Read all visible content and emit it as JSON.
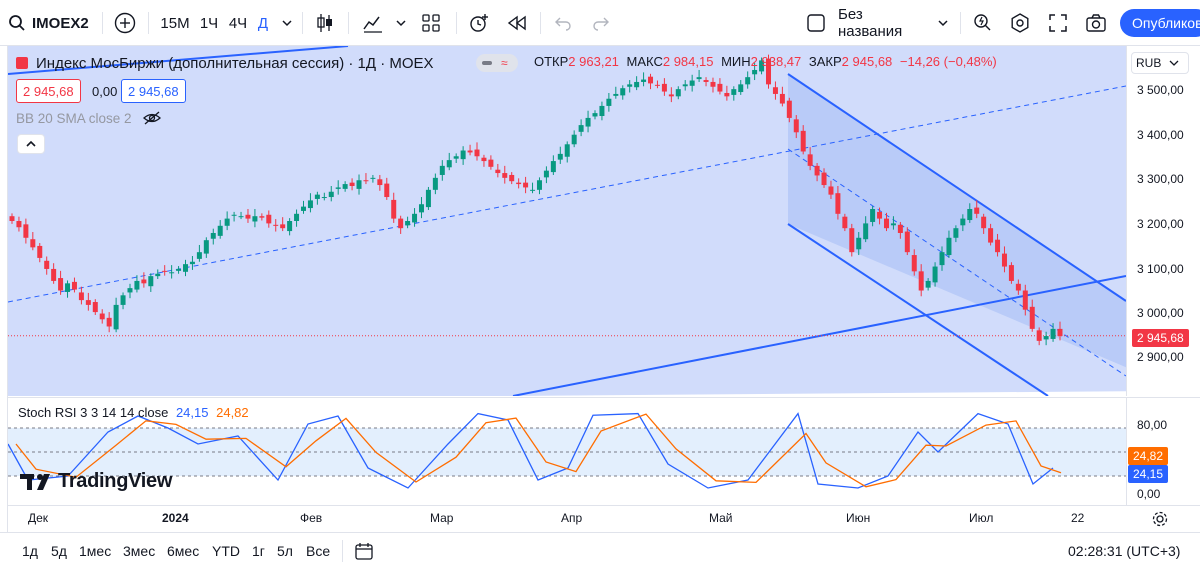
{
  "toolbar": {
    "symbol": "IMOEX2",
    "add_label": "+",
    "intervals": [
      "15М",
      "1Ч",
      "4Ч",
      "Д"
    ],
    "active_interval": "Д",
    "layout_name": "Без названия",
    "publish_label": "Опубликов"
  },
  "legend": {
    "title": "Индекс МосБиржи (дополнительная сессия) · 1Д · MOEX",
    "open_label": "ОТКР",
    "open": "2 963,21",
    "high_label": "МАКС",
    "high": "2 984,15",
    "low_label": "МИН",
    "low": "2 938,47",
    "close_label": "ЗАКР",
    "close": "2 945,68",
    "change": "−14,26 (−0,48%)",
    "bid": "2 945,68",
    "spread": "0,00",
    "ask": "2 945,68",
    "bb_label": "BB 20 SMA close 2",
    "collapse_icon": "^"
  },
  "price_scale": {
    "currency": "RUB",
    "ticks": [
      "3 500,00",
      "3 400,00",
      "3 300,00",
      "3 200,00",
      "3 100,00",
      "3 000,00",
      "2 900,00"
    ],
    "last_price": "2 945,68"
  },
  "rsi": {
    "label": "Stoch RSI 3 3 14 14 close",
    "k_value": "24,15",
    "d_value": "24,82",
    "ticks": [
      "80,00",
      "0,00"
    ],
    "k_badge": "24,15",
    "d_badge": "24,82"
  },
  "branding": {
    "logo_text": "TradingView"
  },
  "time_scale": {
    "labels": [
      "Дек",
      "2024",
      "Фев",
      "Мар",
      "Апр",
      "Май",
      "Июн",
      "Июл",
      "22"
    ]
  },
  "bottom_bar": {
    "ranges": [
      "1д",
      "5д",
      "1мес",
      "3мес",
      "6мес",
      "YTD",
      "1г",
      "5л",
      "Все"
    ],
    "clock": "02:28:31 (UTC+3)"
  },
  "colors": {
    "up": "#089981",
    "down": "#f23645",
    "accent": "#2962ff",
    "bb_fill": "#d1dcfb",
    "channel_fill": "#a6bdf5",
    "rsi_k": "#2962ff",
    "rsi_d": "#ff6d00"
  },
  "chart_data": {
    "type": "candlestick",
    "ylim": [
      2820,
      3550
    ],
    "closes": [
      3185,
      3172,
      3150,
      3130,
      3108,
      3085,
      3060,
      3040,
      3055,
      3042,
      3020,
      3010,
      2995,
      2980,
      2965,
      3010,
      3030,
      3045,
      3060,
      3055,
      3070,
      3075,
      3080,
      3078,
      3085,
      3095,
      3100,
      3120,
      3145,
      3160,
      3175,
      3190,
      3198,
      3195,
      3190,
      3195,
      3192,
      3180,
      3175,
      3170,
      3185,
      3200,
      3215,
      3228,
      3240,
      3235,
      3246,
      3255,
      3262,
      3258,
      3270,
      3268,
      3275,
      3260,
      3235,
      3190,
      3170,
      3185,
      3200,
      3220,
      3250,
      3275,
      3300,
      3312,
      3320,
      3332,
      3328,
      3320,
      3310,
      3298,
      3285,
      3275,
      3268,
      3262,
      3255,
      3250,
      3270,
      3290,
      3310,
      3325,
      3345,
      3365,
      3385,
      3400,
      3410,
      3425,
      3440,
      3450,
      3462,
      3470,
      3475,
      3480,
      3472,
      3468,
      3455,
      3445,
      3460,
      3470,
      3478,
      3485,
      3475,
      3465,
      3455,
      3445,
      3460,
      3470,
      3485,
      3500,
      3520,
      3470,
      3450,
      3430,
      3400,
      3370,
      3330,
      3300,
      3280,
      3260,
      3240,
      3200,
      3170,
      3120,
      3150,
      3180,
      3210,
      3190,
      3170,
      3180,
      3160,
      3120,
      3080,
      3040,
      3060,
      3090,
      3120,
      3150,
      3170,
      3190,
      3210,
      3200,
      3170,
      3140,
      3120,
      3090,
      3060,
      3040,
      3000,
      2960,
      2935,
      2945,
      2960,
      2945
    ]
  }
}
